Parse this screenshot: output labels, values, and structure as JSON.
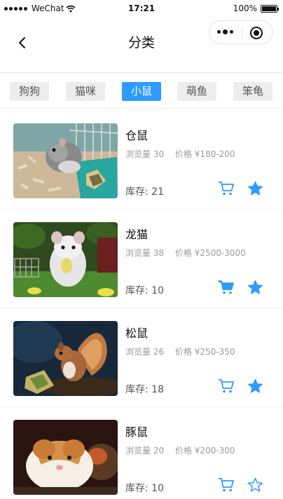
{
  "status_bar": {
    "carrier": "WeChat",
    "time": "17:21",
    "battery": "100%"
  },
  "nav": {
    "title": "分类"
  },
  "tabs": [
    {
      "label": "狗狗",
      "active": false
    },
    {
      "label": "猫咪",
      "active": false
    },
    {
      "label": "小鼠",
      "active": true
    },
    {
      "label": "萌鱼",
      "active": false
    },
    {
      "label": "笨龟",
      "active": false
    }
  ],
  "list_labels": {
    "views": "浏览量",
    "price": "价格",
    "stock": "库存:"
  },
  "items": [
    {
      "name": "仓鼠",
      "views": "30",
      "price": "¥180-200",
      "stock": "21",
      "cart_filled": false,
      "favorited": true
    },
    {
      "name": "龙猫",
      "views": "38",
      "price": "¥2500-3000",
      "stock": "10",
      "cart_filled": true,
      "favorited": true
    },
    {
      "name": "松鼠",
      "views": "26",
      "price": "¥250-350",
      "stock": "18",
      "cart_filled": false,
      "favorited": true
    },
    {
      "name": "豚鼠",
      "views": "20",
      "price": "¥200-300",
      "stock": "10",
      "cart_filled": false,
      "favorited": false
    }
  ],
  "colors": {
    "accent": "#2d9bff",
    "tab_inactive_bg": "#ededed",
    "meta_text": "#9a9a9a"
  },
  "icons": [
    "back-arrow-icon",
    "more-icon",
    "target-icon",
    "cart-icon",
    "star-icon"
  ]
}
